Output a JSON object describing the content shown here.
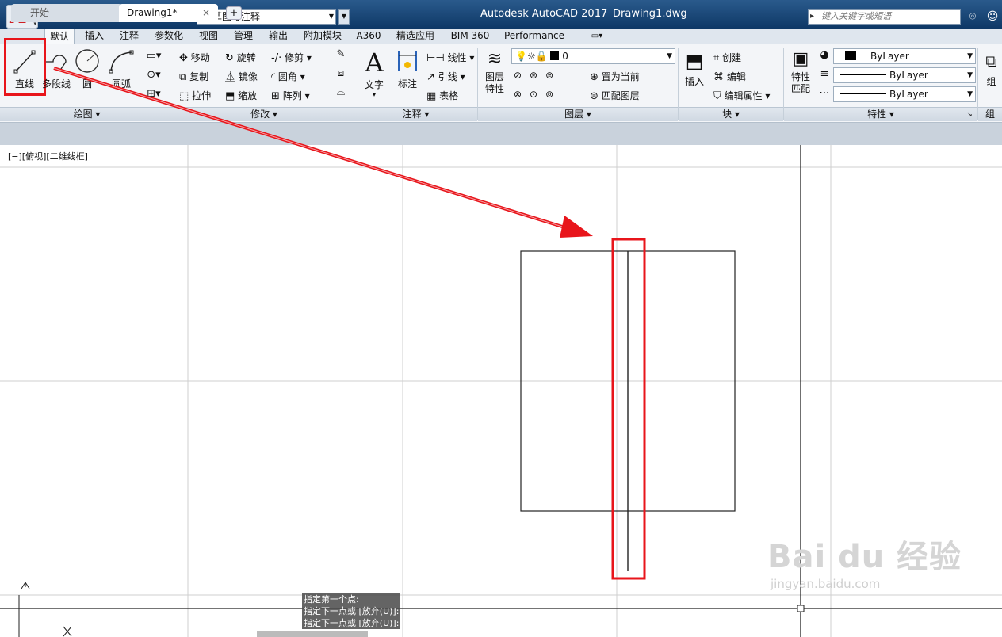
{
  "titlebar": {
    "app_title": "Autodesk AutoCAD 2017",
    "file_name": "Drawing1.dwg",
    "workspace": "草图与注释",
    "search_placeholder": "键入关键字或短语",
    "app_menu_letter": "A"
  },
  "ribbon_tabs": [
    "默认",
    "插入",
    "注释",
    "参数化",
    "视图",
    "管理",
    "输出",
    "附加模块",
    "A360",
    "精选应用",
    "BIM 360",
    "Performance"
  ],
  "draw_panel": {
    "title": "绘图",
    "line": "直线",
    "polyline": "多段线",
    "circle": "圆",
    "arc": "圆弧"
  },
  "modify_panel": {
    "title": "修改",
    "move": "移动",
    "rotate": "旋转",
    "trim": "修剪",
    "copy": "复制",
    "mirror": "镜像",
    "fillet": "圆角",
    "stretch": "拉伸",
    "scale": "缩放",
    "array": "阵列"
  },
  "annotation_panel": {
    "title": "注释",
    "text": "文字",
    "dimension": "标注",
    "linear": "线性",
    "leader": "引线",
    "table": "表格"
  },
  "layers_panel": {
    "title": "图层",
    "layer_properties": "图层\n特性",
    "current_layer": "0",
    "make_current": "置为当前",
    "match_layer": "匹配图层"
  },
  "block_panel": {
    "title": "块",
    "insert": "插入",
    "create": "创建",
    "edit": "编辑",
    "edit_attributes": "编辑属性"
  },
  "properties_panel": {
    "title": "特性",
    "match_properties": "特性\n匹配",
    "color": "ByLayer",
    "linetype": "ByLayer",
    "lineweight": "ByLayer"
  },
  "groups_panel": {
    "group": "组",
    "title": "组"
  },
  "doc_tabs": {
    "start": "开始",
    "drawing": "Drawing1*",
    "close": "×",
    "add": "+"
  },
  "viewport_label": "[−][俯视][二维线框]",
  "command_history": [
    "指定第一个点:",
    "指定下一点或 [放弃(U)]:",
    "指定下一点或 [放弃(U)]:"
  ],
  "ucs": {
    "y": "Y",
    "x": "X"
  },
  "watermark": {
    "brand": "Bai du 经验",
    "url": "jingyan.baidu.com"
  },
  "colors": {
    "highlight": "#e8151b",
    "title_bg": "#1d4a7a",
    "ribbon_bg": "#f3f5f8"
  }
}
